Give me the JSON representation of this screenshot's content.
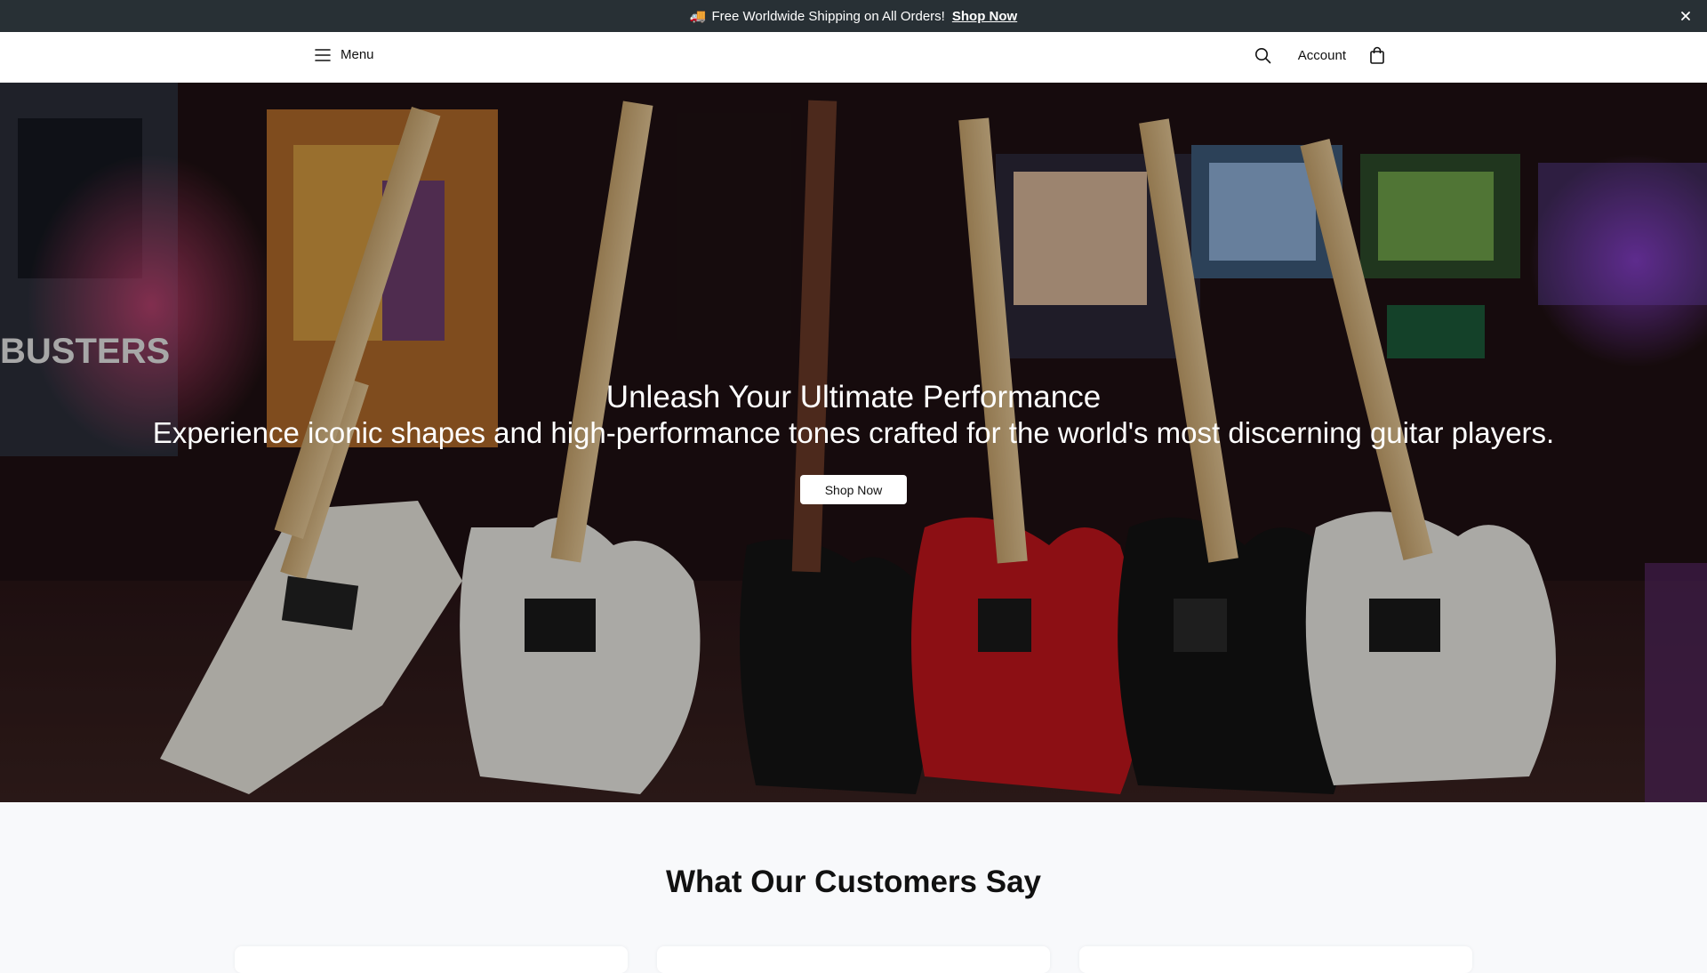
{
  "announcement": {
    "icon": "truck-icon",
    "text": "Free Worldwide Shipping on All Orders!",
    "link_label": "Shop Now"
  },
  "header": {
    "menu_label": "Menu",
    "account_label": "Account",
    "icons": [
      "hamburger-icon",
      "search-icon",
      "shopping-bag-icon"
    ]
  },
  "hero": {
    "title": "Unleash Your Ultimate Performance",
    "subtitle": "Experience iconic shapes and high-performance tones crafted for the world's most discerning guitar players.",
    "button_label": "Shop Now"
  },
  "testimonials": {
    "heading": "What Our Customers Say",
    "card_count": 3
  },
  "colors": {
    "announcement_bg": "#283035",
    "header_bg": "#ffffff",
    "page_bg": "#f8f9fb",
    "button_bg": "#ffffff"
  }
}
